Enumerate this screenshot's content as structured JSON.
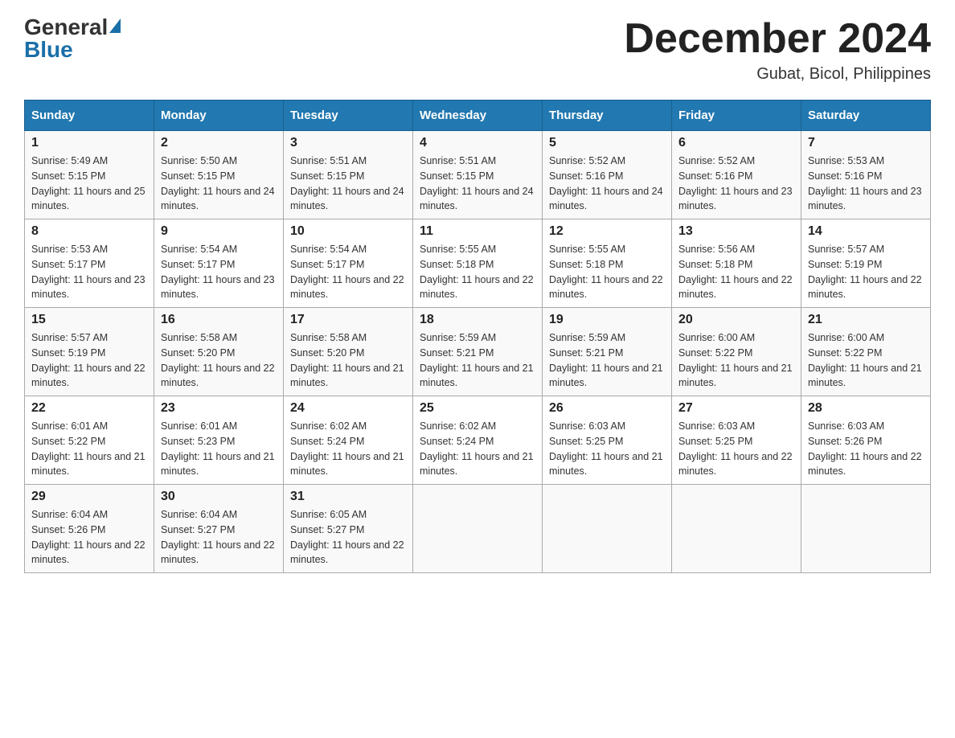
{
  "logo": {
    "general": "General",
    "blue": "Blue"
  },
  "title": "December 2024",
  "subtitle": "Gubat, Bicol, Philippines",
  "days_header": [
    "Sunday",
    "Monday",
    "Tuesday",
    "Wednesday",
    "Thursday",
    "Friday",
    "Saturday"
  ],
  "weeks": [
    [
      {
        "day": "1",
        "sunrise": "Sunrise: 5:49 AM",
        "sunset": "Sunset: 5:15 PM",
        "daylight": "Daylight: 11 hours and 25 minutes."
      },
      {
        "day": "2",
        "sunrise": "Sunrise: 5:50 AM",
        "sunset": "Sunset: 5:15 PM",
        "daylight": "Daylight: 11 hours and 24 minutes."
      },
      {
        "day": "3",
        "sunrise": "Sunrise: 5:51 AM",
        "sunset": "Sunset: 5:15 PM",
        "daylight": "Daylight: 11 hours and 24 minutes."
      },
      {
        "day": "4",
        "sunrise": "Sunrise: 5:51 AM",
        "sunset": "Sunset: 5:15 PM",
        "daylight": "Daylight: 11 hours and 24 minutes."
      },
      {
        "day": "5",
        "sunrise": "Sunrise: 5:52 AM",
        "sunset": "Sunset: 5:16 PM",
        "daylight": "Daylight: 11 hours and 24 minutes."
      },
      {
        "day": "6",
        "sunrise": "Sunrise: 5:52 AM",
        "sunset": "Sunset: 5:16 PM",
        "daylight": "Daylight: 11 hours and 23 minutes."
      },
      {
        "day": "7",
        "sunrise": "Sunrise: 5:53 AM",
        "sunset": "Sunset: 5:16 PM",
        "daylight": "Daylight: 11 hours and 23 minutes."
      }
    ],
    [
      {
        "day": "8",
        "sunrise": "Sunrise: 5:53 AM",
        "sunset": "Sunset: 5:17 PM",
        "daylight": "Daylight: 11 hours and 23 minutes."
      },
      {
        "day": "9",
        "sunrise": "Sunrise: 5:54 AM",
        "sunset": "Sunset: 5:17 PM",
        "daylight": "Daylight: 11 hours and 23 minutes."
      },
      {
        "day": "10",
        "sunrise": "Sunrise: 5:54 AM",
        "sunset": "Sunset: 5:17 PM",
        "daylight": "Daylight: 11 hours and 22 minutes."
      },
      {
        "day": "11",
        "sunrise": "Sunrise: 5:55 AM",
        "sunset": "Sunset: 5:18 PM",
        "daylight": "Daylight: 11 hours and 22 minutes."
      },
      {
        "day": "12",
        "sunrise": "Sunrise: 5:55 AM",
        "sunset": "Sunset: 5:18 PM",
        "daylight": "Daylight: 11 hours and 22 minutes."
      },
      {
        "day": "13",
        "sunrise": "Sunrise: 5:56 AM",
        "sunset": "Sunset: 5:18 PM",
        "daylight": "Daylight: 11 hours and 22 minutes."
      },
      {
        "day": "14",
        "sunrise": "Sunrise: 5:57 AM",
        "sunset": "Sunset: 5:19 PM",
        "daylight": "Daylight: 11 hours and 22 minutes."
      }
    ],
    [
      {
        "day": "15",
        "sunrise": "Sunrise: 5:57 AM",
        "sunset": "Sunset: 5:19 PM",
        "daylight": "Daylight: 11 hours and 22 minutes."
      },
      {
        "day": "16",
        "sunrise": "Sunrise: 5:58 AM",
        "sunset": "Sunset: 5:20 PM",
        "daylight": "Daylight: 11 hours and 22 minutes."
      },
      {
        "day": "17",
        "sunrise": "Sunrise: 5:58 AM",
        "sunset": "Sunset: 5:20 PM",
        "daylight": "Daylight: 11 hours and 21 minutes."
      },
      {
        "day": "18",
        "sunrise": "Sunrise: 5:59 AM",
        "sunset": "Sunset: 5:21 PM",
        "daylight": "Daylight: 11 hours and 21 minutes."
      },
      {
        "day": "19",
        "sunrise": "Sunrise: 5:59 AM",
        "sunset": "Sunset: 5:21 PM",
        "daylight": "Daylight: 11 hours and 21 minutes."
      },
      {
        "day": "20",
        "sunrise": "Sunrise: 6:00 AM",
        "sunset": "Sunset: 5:22 PM",
        "daylight": "Daylight: 11 hours and 21 minutes."
      },
      {
        "day": "21",
        "sunrise": "Sunrise: 6:00 AM",
        "sunset": "Sunset: 5:22 PM",
        "daylight": "Daylight: 11 hours and 21 minutes."
      }
    ],
    [
      {
        "day": "22",
        "sunrise": "Sunrise: 6:01 AM",
        "sunset": "Sunset: 5:22 PM",
        "daylight": "Daylight: 11 hours and 21 minutes."
      },
      {
        "day": "23",
        "sunrise": "Sunrise: 6:01 AM",
        "sunset": "Sunset: 5:23 PM",
        "daylight": "Daylight: 11 hours and 21 minutes."
      },
      {
        "day": "24",
        "sunrise": "Sunrise: 6:02 AM",
        "sunset": "Sunset: 5:24 PM",
        "daylight": "Daylight: 11 hours and 21 minutes."
      },
      {
        "day": "25",
        "sunrise": "Sunrise: 6:02 AM",
        "sunset": "Sunset: 5:24 PM",
        "daylight": "Daylight: 11 hours and 21 minutes."
      },
      {
        "day": "26",
        "sunrise": "Sunrise: 6:03 AM",
        "sunset": "Sunset: 5:25 PM",
        "daylight": "Daylight: 11 hours and 21 minutes."
      },
      {
        "day": "27",
        "sunrise": "Sunrise: 6:03 AM",
        "sunset": "Sunset: 5:25 PM",
        "daylight": "Daylight: 11 hours and 22 minutes."
      },
      {
        "day": "28",
        "sunrise": "Sunrise: 6:03 AM",
        "sunset": "Sunset: 5:26 PM",
        "daylight": "Daylight: 11 hours and 22 minutes."
      }
    ],
    [
      {
        "day": "29",
        "sunrise": "Sunrise: 6:04 AM",
        "sunset": "Sunset: 5:26 PM",
        "daylight": "Daylight: 11 hours and 22 minutes."
      },
      {
        "day": "30",
        "sunrise": "Sunrise: 6:04 AM",
        "sunset": "Sunset: 5:27 PM",
        "daylight": "Daylight: 11 hours and 22 minutes."
      },
      {
        "day": "31",
        "sunrise": "Sunrise: 6:05 AM",
        "sunset": "Sunset: 5:27 PM",
        "daylight": "Daylight: 11 hours and 22 minutes."
      },
      null,
      null,
      null,
      null
    ]
  ]
}
